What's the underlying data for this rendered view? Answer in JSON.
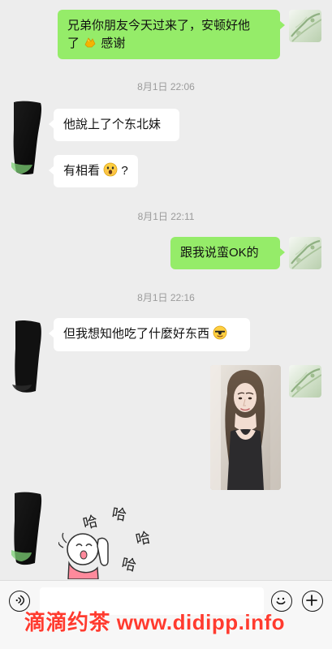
{
  "messages": {
    "m1": {
      "text_1": "兄弟你朋友今天过来了，安顿好他",
      "text_2": "了",
      "text_3": "感谢"
    },
    "t1": "8月1日 22:06",
    "m2": {
      "text": "他說上了个东北妹"
    },
    "m3": {
      "text_1": "有相看",
      "text_2": "?"
    },
    "t2": "8月1日 22:11",
    "m4": {
      "text": "跟我说蛮OK的"
    },
    "t3": "8月1日 22:16",
    "m5": {
      "text": "但我想知他吃了什麼好东西"
    },
    "sticker": {
      "text_1": "哈",
      "text_2": "哈",
      "text_3": "哈",
      "text_4": "哈"
    }
  },
  "watermark": "滴滴约茶 www.didipp.info",
  "icons": {
    "voice": "voice-icon",
    "emoji": "emoji-icon",
    "plus": "plus-icon",
    "clap": "clap-emoji-icon",
    "scream": "scream-emoji-icon",
    "sunglasses": "sunglasses-emoji-icon"
  },
  "colors": {
    "chat_background": "#ededed",
    "outgoing_bubble": "#95ec69",
    "incoming_bubble": "#ffffff",
    "watermark": "#ff3b2f"
  }
}
